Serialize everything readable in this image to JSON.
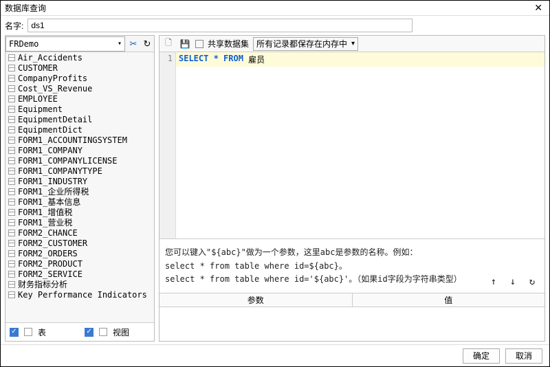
{
  "window": {
    "title": "数据库查询"
  },
  "name_row": {
    "label": "名字:",
    "value": "ds1"
  },
  "left": {
    "database": "FRDemo",
    "tables": [
      "Air_Accidents",
      "CUSTOMER",
      "CompanyProfits",
      "Cost_VS_Revenue",
      "EMPLOYEE",
      "Equipment",
      "EquipmentDetail",
      "EquipmentDict",
      "FORM1_ACCOUNTINGSYSTEM",
      "FORM1_COMPANY",
      "FORM1_COMPANYLICENSE",
      "FORM1_COMPANYTYPE",
      "FORM1_INDUSTRY",
      "FORM1_企业所得税",
      "FORM1_基本信息",
      "FORM1_增值税",
      "FORM1_营业税",
      "FORM2_CHANCE",
      "FORM2_CUSTOMER",
      "FORM2_ORDERS",
      "FORM2_PRODUCT",
      "FORM2_SERVICE",
      "财务指标分析",
      "Key Performance Indicators"
    ],
    "footer": {
      "table_label": "表",
      "view_label": "视图"
    }
  },
  "right": {
    "share_label": "共享数据集",
    "memory_mode": "所有记录都保存在内存中",
    "code": {
      "kw_select": "SELECT",
      "kw_star": "*",
      "kw_from": "FROM",
      "ident": "雇员"
    },
    "hint": {
      "line1": "您可以键入\"${abc}\"做为一个参数，这里abc是参数的名称。例如：",
      "line2": "select * from table where id=${abc}。",
      "line3": "select * from table where id='${abc}'。（如果id字段为字符串类型）"
    },
    "param_header": {
      "param": "参数",
      "value": "值"
    }
  },
  "footer": {
    "ok": "确定",
    "cancel": "取消"
  }
}
